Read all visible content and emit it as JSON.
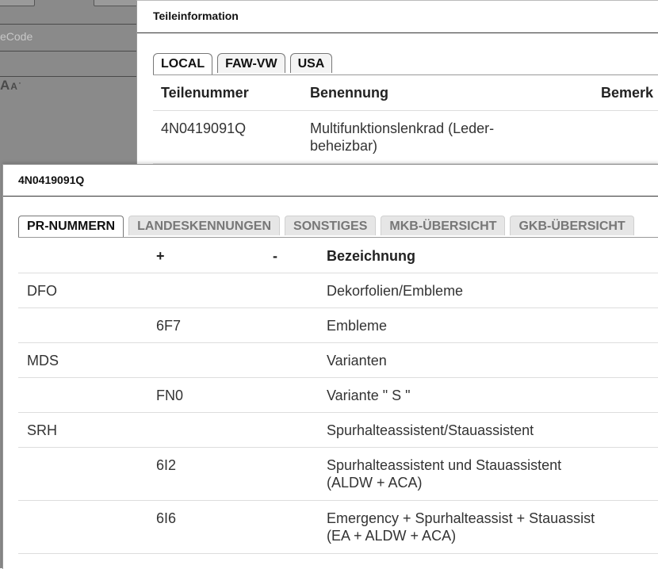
{
  "background": {
    "code_label": "eCode",
    "font_size_control": {
      "large": "A",
      "small": "A"
    }
  },
  "dialog_parts": {
    "title": "Teileinformation",
    "tabs": [
      "LOCAL",
      "FAW-VW",
      "USA"
    ],
    "columns": {
      "part_number": "Teilenummer",
      "name": "Benennung",
      "remark": "Bemerk"
    },
    "rows": [
      {
        "part_number": "4N0419091Q",
        "name": "Multifunktionslenkrad (Leder-\nbeheizbar)"
      }
    ]
  },
  "dialog_pr": {
    "title": "4N0419091Q",
    "tabs": [
      "PR-NUMMERN",
      "LANDESKENNUNGEN",
      "SONSTIGES",
      "MKB-ÜBERSICHT",
      "GKB-ÜBERSICHT"
    ],
    "columns": {
      "family": "",
      "plus": "+",
      "minus": "-",
      "desc": "Bezeichnung"
    },
    "rows": [
      {
        "family": "DFO",
        "plus": "",
        "minus": "",
        "desc": "Dekorfolien/Embleme"
      },
      {
        "family": "",
        "plus": "6F7",
        "minus": "",
        "desc": "Embleme"
      },
      {
        "family": "MDS",
        "plus": "",
        "minus": "",
        "desc": "Varianten"
      },
      {
        "family": "",
        "plus": "FN0",
        "minus": "",
        "desc": "Variante \" S \""
      },
      {
        "family": "SRH",
        "plus": "",
        "minus": "",
        "desc": "Spurhalteassistent/Stauassistent"
      },
      {
        "family": "",
        "plus": "6I2",
        "minus": "",
        "desc": "Spurhalteassistent und Stauassistent\n(ALDW + ACA)"
      },
      {
        "family": "",
        "plus": "6I6",
        "minus": "",
        "desc": "Emergency + Spurhalteassist + Stauassist\n(EA + ALDW + ACA)"
      }
    ]
  }
}
